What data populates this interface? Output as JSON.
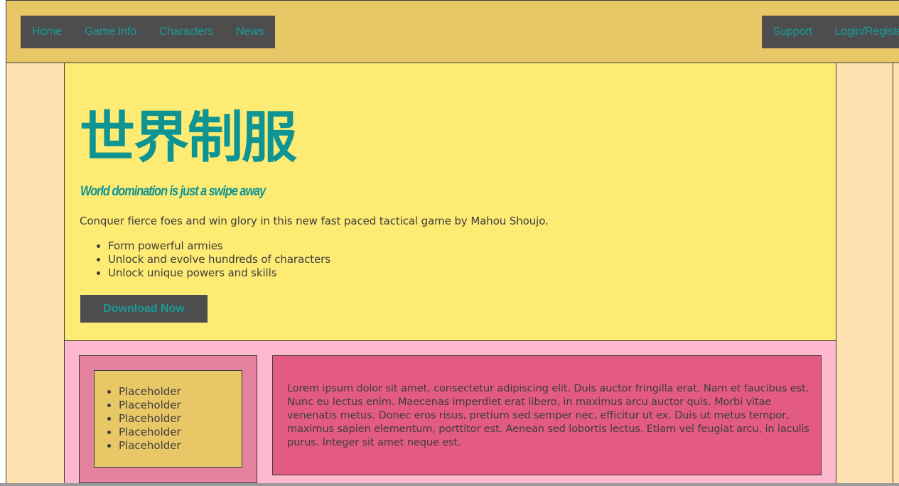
{
  "nav": {
    "left": [
      {
        "label": "Home"
      },
      {
        "label": "Game Info"
      },
      {
        "label": "Characters"
      },
      {
        "label": "News"
      }
    ],
    "right": [
      {
        "label": "Support"
      },
      {
        "label": "Login/Register"
      }
    ]
  },
  "hero": {
    "title": "世界制服",
    "tagline": "World domination is just a swipe away",
    "description": "Conquer fierce foes and win glory in this new fast paced tactical game by Mahou Shoujo.",
    "features": [
      "Form powerful armies",
      "Unlock and evolve hundreds of characters",
      "Unlock unique powers and skills"
    ],
    "cta_label": "Download Now"
  },
  "sidebar": {
    "items": [
      "Placeholder",
      "Placeholder",
      "Placeholder",
      "Placeholder",
      "Placeholder"
    ]
  },
  "content": {
    "text": "Lorem ipsum dolor sit amet, consectetur adipiscing elit. Duis auctor fringilla erat. Nam et faucibus est. Nunc eu lectus enim. Maecenas imperdiet erat libero, in maximus arcu auctor quis. Morbi vitae venenatis metus. Donec eros risus, pretium sed semper nec, efficitur ut ex. Duis ut metus tempor, maximus sapien elementum, porttitor est. Aenean sed lobortis lectus. Etiam vel feugiat arcu, in iaculis purus. Integer sit amet neque est."
  },
  "colors": {
    "header_bg": "#e7c766",
    "nav_bg": "#4d4d4d",
    "accent_teal": "#0e9493",
    "hero_bg": "#feeb73",
    "lower_bg": "#ffb9cf",
    "content_bg": "#e35b83",
    "page_bg": "#fee2b2"
  }
}
